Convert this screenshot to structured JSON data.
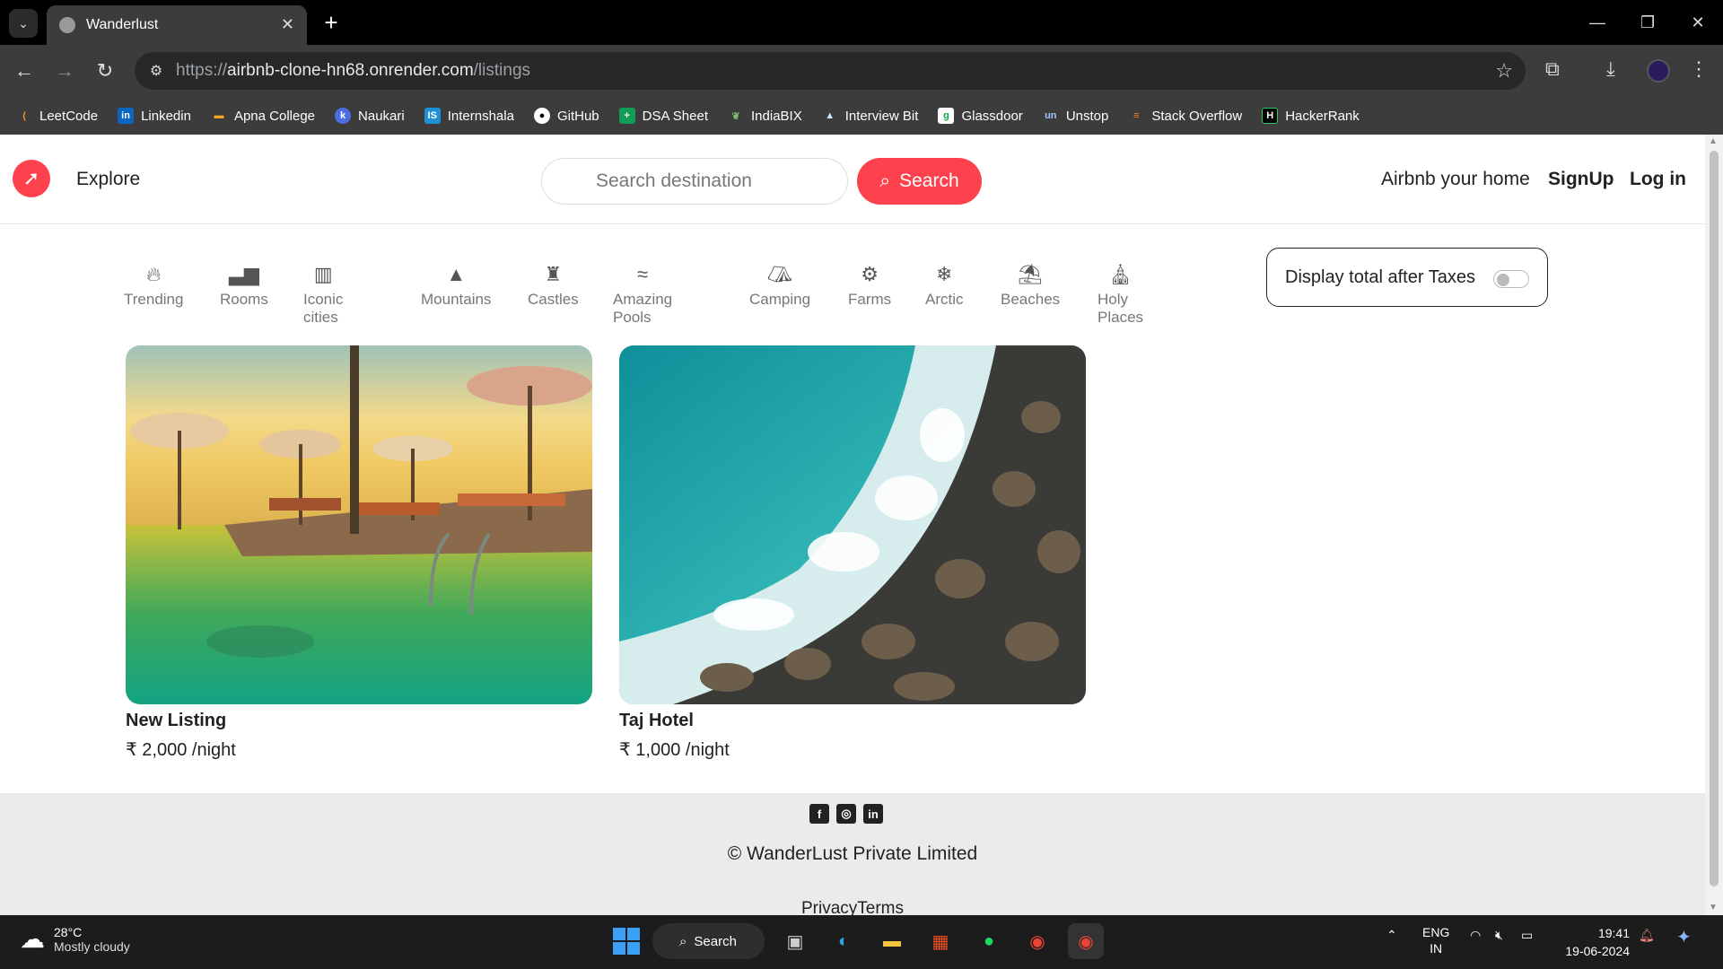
{
  "browser": {
    "tab_title": "Wanderlust",
    "url_prefix": "https://",
    "url_host": "airbnb-clone-hn68.onrender.com",
    "url_path": "/listings",
    "bookmarks": [
      "LeetCode",
      "Linkedin",
      "Apna College",
      "Naukari",
      "Internshala",
      "GitHub",
      "DSA Sheet",
      "IndiaBIX",
      "Interview Bit",
      "Glassdoor",
      "Unstop",
      "Stack Overflow",
      "HackerRank"
    ]
  },
  "navbar": {
    "explore": "Explore",
    "search_placeholder": "Search destination",
    "search_button": "Search",
    "airbnb_home": "Airbnb your home",
    "signup": "SignUp",
    "login": "Log in"
  },
  "filters": [
    "Trending",
    "Rooms",
    "Iconic cities",
    "Mountains",
    "Castles",
    "Amazing Pools",
    "Camping",
    "Farms",
    "Arctic",
    "Beaches",
    "Holy Places"
  ],
  "tax_toggle": {
    "label": "Display total after Taxes",
    "enabled": false
  },
  "listings": [
    {
      "title": "New Listing",
      "price": "₹ 2,000 /night"
    },
    {
      "title": "Taj Hotel",
      "price": "₹ 1,000 /night"
    }
  ],
  "footer": {
    "copyright": "© WanderLust Private Limited",
    "links": "PrivacyTerms"
  },
  "taskbar": {
    "temperature": "28°C",
    "weather": "Mostly cloudy",
    "search": "Search",
    "lang1": "ENG",
    "lang2": "IN",
    "time": "19:41",
    "date": "19-06-2024"
  },
  "colors": {
    "brand": "#fe424d",
    "chrome_dark": "#3c3c3c",
    "footer_bg": "#ebebeb"
  }
}
